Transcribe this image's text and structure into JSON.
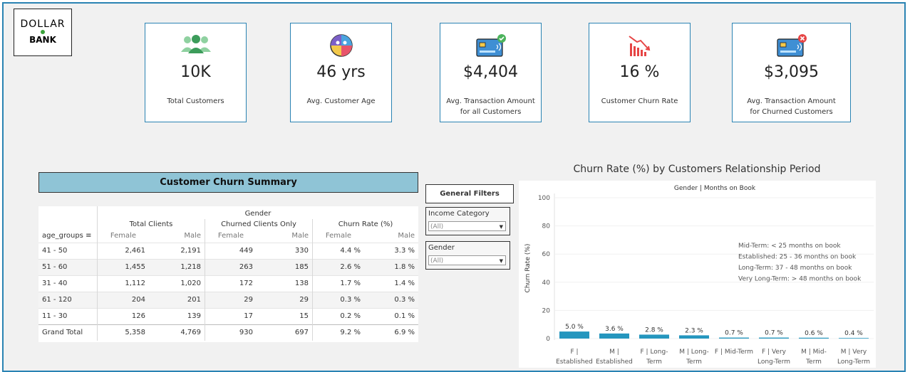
{
  "logo": {
    "line1": "DOLLAR",
    "line2": "BANK"
  },
  "kpis": [
    {
      "value": "10K",
      "label": "Total Customers",
      "icon": "users-icon"
    },
    {
      "value": "46 yrs",
      "label": "Avg. Customer Age",
      "icon": "age-icon"
    },
    {
      "value": "$4,404",
      "label": "Avg. Transaction Amount\nfor all Customers",
      "icon": "credit-card-check-icon"
    },
    {
      "value": "16 %",
      "label": "Customer Churn Rate",
      "icon": "declining-chart-icon"
    },
    {
      "value": "$3,095",
      "label": "Avg. Transaction Amount\nfor Churned Customers",
      "icon": "credit-card-cancel-icon"
    }
  ],
  "summary": {
    "title": "Customer Churn Summary",
    "header": {
      "gender": "Gender",
      "total_clients": "Total Clients",
      "churned_only": "Churned Clients Only",
      "churn_rate": "Churn Rate (%)",
      "age_groups": "age_groups",
      "female": "Female",
      "male": "Male"
    },
    "rows": [
      {
        "group": "41 - 50",
        "tf": "2,461",
        "tm": "2,191",
        "cf": "449",
        "cm": "330",
        "rf": "4.4 %",
        "rm": "3.3 %"
      },
      {
        "group": "51 - 60",
        "tf": "1,455",
        "tm": "1,218",
        "cf": "263",
        "cm": "185",
        "rf": "2.6 %",
        "rm": "1.8 %"
      },
      {
        "group": "31 - 40",
        "tf": "1,112",
        "tm": "1,020",
        "cf": "172",
        "cm": "138",
        "rf": "1.7 %",
        "rm": "1.4 %"
      },
      {
        "group": "61 - 120",
        "tf": "204",
        "tm": "201",
        "cf": "29",
        "cm": "29",
        "rf": "0.3 %",
        "rm": "0.3 %"
      },
      {
        "group": "11 - 30",
        "tf": "126",
        "tm": "139",
        "cf": "17",
        "cm": "15",
        "rf": "0.2 %",
        "rm": "0.1 %"
      }
    ],
    "total": {
      "group": "Grand Total",
      "tf": "5,358",
      "tm": "4,769",
      "cf": "930",
      "cm": "697",
      "rf": "9.2 %",
      "rm": "6.9 %"
    }
  },
  "filters": {
    "title": "General Filters",
    "income": {
      "label": "Income Category",
      "value": "(All)"
    },
    "gender": {
      "label": "Gender",
      "value": "(All)"
    }
  },
  "chart_data": {
    "type": "bar",
    "title": "Churn Rate (%) by Customers Relationship Period",
    "subtitle": "Gender | Months on Book",
    "ylabel": "Churn Rate (%)",
    "ylim": [
      0,
      100
    ],
    "yticks": [
      0,
      20,
      40,
      60,
      80,
      100
    ],
    "color": "#2596be",
    "categories": [
      [
        "F |",
        "Established"
      ],
      [
        "M |",
        "Established"
      ],
      [
        "F | Long-",
        "Term"
      ],
      [
        "M | Long-",
        "Term"
      ],
      [
        "F | Mid-Term"
      ],
      [
        "F | Very",
        "Long-Term"
      ],
      [
        "M | Mid-",
        "Term"
      ],
      [
        "M | Very",
        "Long-Term"
      ]
    ],
    "values": [
      5.0,
      3.6,
      2.8,
      2.3,
      0.7,
      0.7,
      0.6,
      0.4
    ],
    "data_labels": [
      "5.0 %",
      "3.6 %",
      "2.8 %",
      "2.3 %",
      "0.7 %",
      "0.7 %",
      "0.6 %",
      "0.4 %"
    ],
    "annotations": [
      "Mid-Term: < 25 months on book",
      "Established: 25 - 36 months on book",
      "Long-Term: 37 - 48 months on book",
      "Very Long-Term: > 48 months on book"
    ]
  }
}
